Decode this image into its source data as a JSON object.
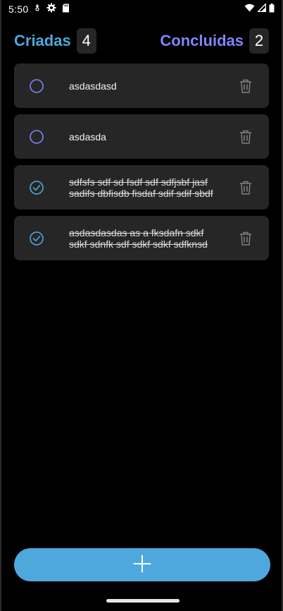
{
  "status_bar": {
    "time": "5:50",
    "icons": [
      "mic-notification-icon",
      "gear-icon",
      "sd-card-icon",
      "wifi-icon",
      "signal-icon",
      "battery-icon"
    ]
  },
  "counters": {
    "created": {
      "label": "Criadas",
      "count": "4"
    },
    "completed": {
      "label": "Concluidas",
      "count": "2"
    }
  },
  "colors": {
    "background": "#000000",
    "card": "#262626",
    "blue": "#4ea8de",
    "purple": "#8284fa",
    "trash": "#808080"
  },
  "tasks": [
    {
      "text": "asdasdasd",
      "done": false
    },
    {
      "text": "asdasda",
      "done": false
    },
    {
      "text": "sdfsfs sdf sd fsdf sdf sdfjsbf jasf sadifs dbfisdb fisdaf sdif sdif sbdf",
      "done": true
    },
    {
      "text": "asdasdasdas  as a fksdafn sdkf sdkf sdnfk sdf sdkf sdkf sdfknsd",
      "done": true
    }
  ],
  "add_button": {
    "icon": "plus-icon"
  }
}
